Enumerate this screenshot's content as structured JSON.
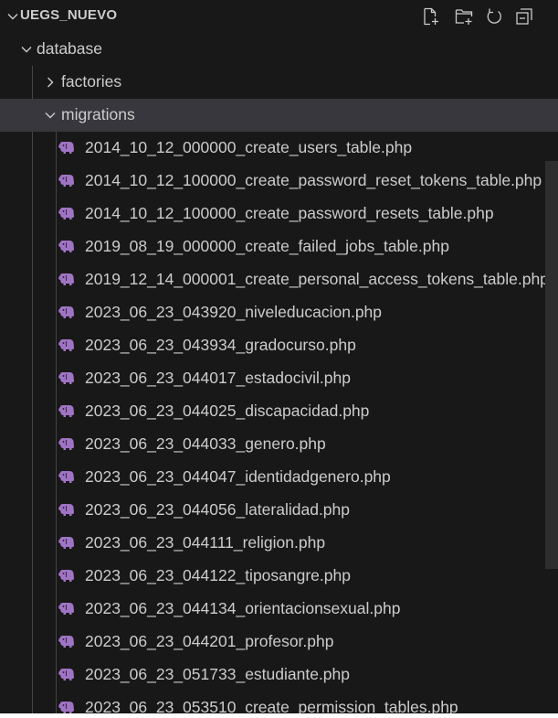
{
  "explorer": {
    "root_label": "UEGS_NUEVO",
    "folders": {
      "database": "database",
      "factories": "factories",
      "migrations": "migrations"
    },
    "files": [
      "2014_10_12_000000_create_users_table.php",
      "2014_10_12_100000_create_password_reset_tokens_table.php",
      "2014_10_12_100000_create_password_resets_table.php",
      "2019_08_19_000000_create_failed_jobs_table.php",
      "2019_12_14_000001_create_personal_access_tokens_table.php",
      "2023_06_23_043920_niveleducacion.php",
      "2023_06_23_043934_gradocurso.php",
      "2023_06_23_044017_estadocivil.php",
      "2023_06_23_044025_discapacidad.php",
      "2023_06_23_044033_genero.php",
      "2023_06_23_044047_identidadgenero.php",
      "2023_06_23_044056_lateralidad.php",
      "2023_06_23_044111_religion.php",
      "2023_06_23_044122_tiposangre.php",
      "2023_06_23_044134_orientacionsexual.php",
      "2023_06_23_044201_profesor.php",
      "2023_06_23_051733_estudiante.php",
      "2023_06_23_053510_create_permission_tables.php"
    ]
  },
  "colors": {
    "background": "#181818",
    "selected_row": "#37373d",
    "text": "#cccccc",
    "php_icon": "#a074c4",
    "scrollbar": "#2e2e2e"
  },
  "icons": {
    "new_file": "new-file-icon",
    "new_folder": "new-folder-icon",
    "refresh": "refresh-icon",
    "collapse_all": "collapse-all-icon",
    "php_file": "php-elephant-icon"
  }
}
